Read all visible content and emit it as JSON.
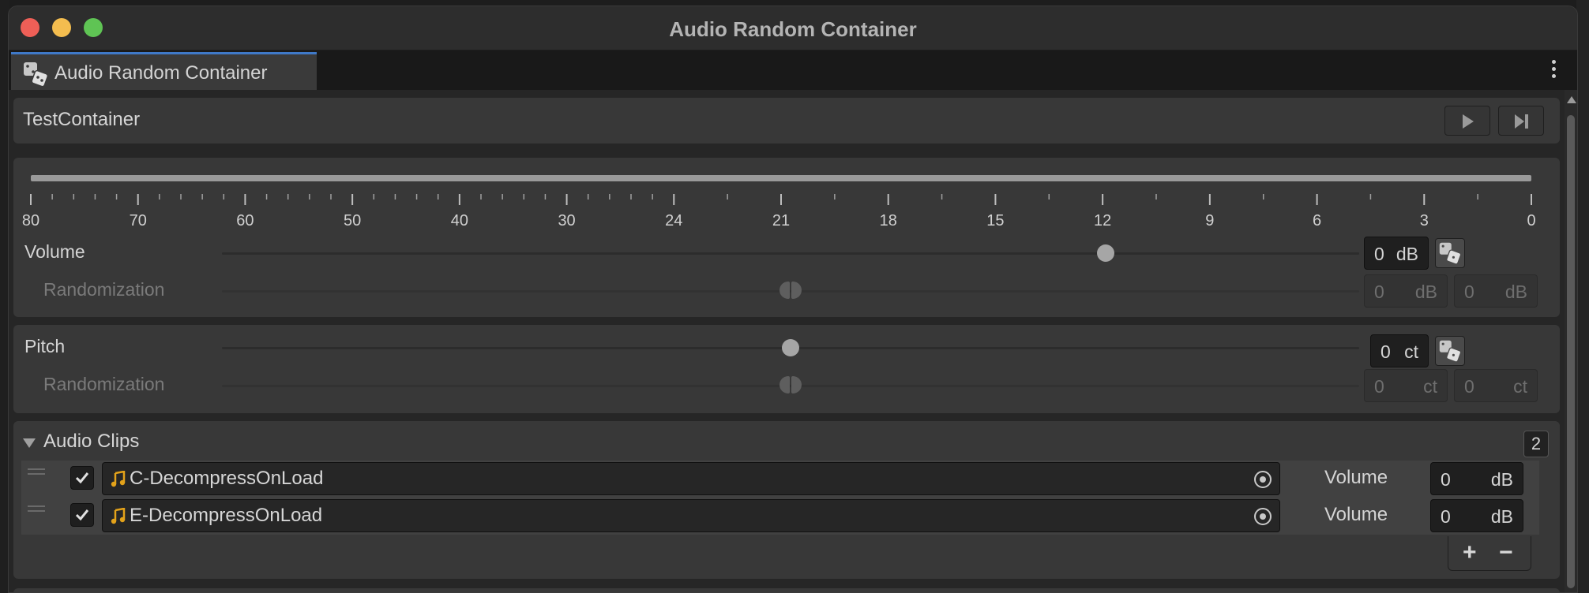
{
  "window": {
    "title": "Audio Random Container"
  },
  "tab": {
    "label": "Audio Random Container",
    "icon": "dice-icon"
  },
  "container": {
    "name": "TestContainer"
  },
  "transport": {
    "play_icon": "play-icon",
    "skip_icon": "skip-next-icon"
  },
  "meter": {
    "scale_labels": [
      "80",
      "70",
      "60",
      "50",
      "40",
      "30",
      "24",
      "21",
      "18",
      "15",
      "12",
      "9",
      "6",
      "3",
      "0"
    ]
  },
  "volume": {
    "label": "Volume",
    "value": "0",
    "unit": "dB",
    "slider_fraction": 0.777,
    "randomization": {
      "label": "Randomization",
      "min": "0",
      "max": "0",
      "unit": "dB"
    }
  },
  "pitch": {
    "label": "Pitch",
    "value": "0",
    "unit": "ct",
    "slider_fraction": 0.5,
    "randomization": {
      "label": "Randomization",
      "min": "0",
      "max": "0",
      "unit": "ct"
    }
  },
  "clips": {
    "header": "Audio Clips",
    "count": "2",
    "items": [
      {
        "name": "C-DecompressOnLoad",
        "enabled": true,
        "volume_label": "Volume",
        "volume": "0",
        "unit": "dB"
      },
      {
        "name": "E-DecompressOnLoad",
        "enabled": true,
        "volume_label": "Volume",
        "volume": "0",
        "unit": "dB"
      }
    ],
    "add_label": "+",
    "remove_label": "−"
  },
  "colors": {
    "accent_tab": "#3f79c8",
    "note_icon": "#e3a21a",
    "traffic_red": "#ee5f57",
    "traffic_yellow": "#f4bd4f",
    "traffic_green": "#5fc454"
  }
}
